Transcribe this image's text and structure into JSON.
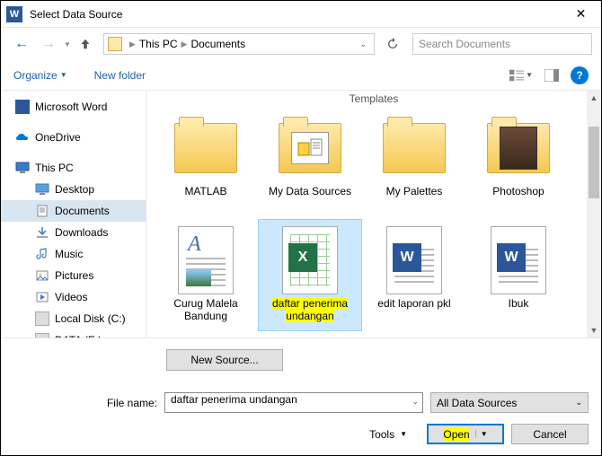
{
  "title": "Select Data Source",
  "breadcrumb": {
    "root": "This PC",
    "current": "Documents"
  },
  "search": {
    "placeholder": "Search Documents"
  },
  "toolbar": {
    "organize": "Organize",
    "new_folder": "New folder"
  },
  "sidebar": {
    "items": [
      {
        "label": "Microsoft Word"
      },
      {
        "label": "OneDrive"
      },
      {
        "label": "This PC"
      },
      {
        "label": "Desktop"
      },
      {
        "label": "Documents"
      },
      {
        "label": "Downloads"
      },
      {
        "label": "Music"
      },
      {
        "label": "Pictures"
      },
      {
        "label": "Videos"
      },
      {
        "label": "Local Disk (C:)"
      },
      {
        "label": "DATA (E:)"
      }
    ]
  },
  "group_header": "Templates",
  "files": [
    {
      "label": "MATLAB"
    },
    {
      "label": "My Data Sources"
    },
    {
      "label": "My Palettes"
    },
    {
      "label": "Photoshop"
    },
    {
      "label": "Curug Malela Bandung"
    },
    {
      "label": "daftar penerima undangan"
    },
    {
      "label": "edit laporan pkl"
    },
    {
      "label": "Ibuk"
    }
  ],
  "footer": {
    "new_source": "New Source...",
    "filename_label": "File name:",
    "filename_value": "daftar penerima undangan",
    "filetype": "All Data Sources",
    "tools": "Tools",
    "open": "Open",
    "cancel": "Cancel"
  }
}
